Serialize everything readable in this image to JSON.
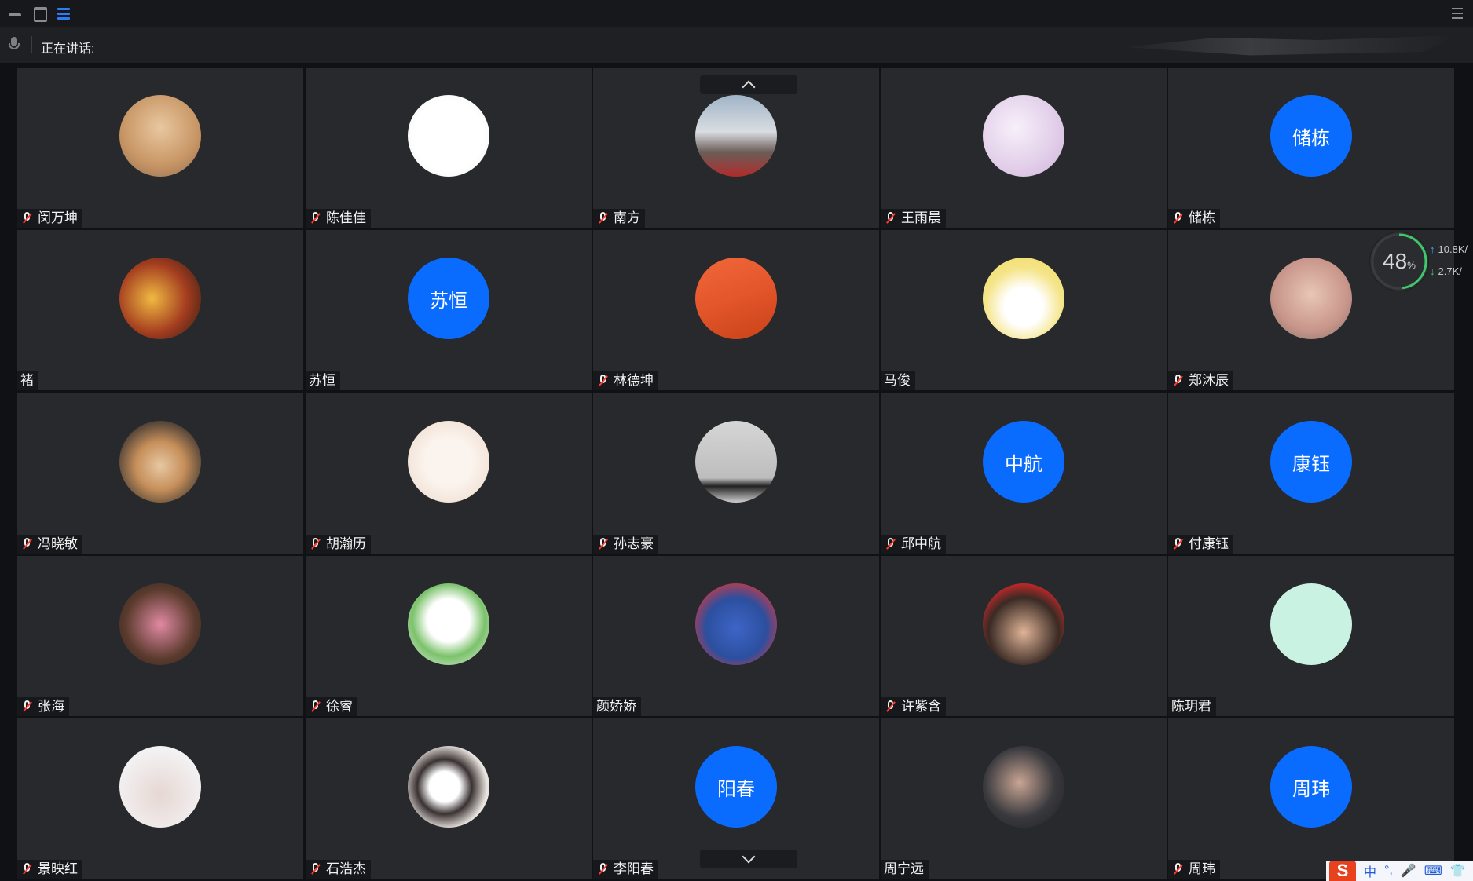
{
  "speaking": {
    "label": "正在讲话:"
  },
  "participants": [
    {
      "name": "闵万坤",
      "muted": true,
      "avatar": "cat-photo"
    },
    {
      "name": "陈佳佳",
      "muted": true,
      "avatar": "sketch-figure"
    },
    {
      "name": "南方",
      "muted": true,
      "avatar": "toy-photo"
    },
    {
      "name": "王雨晨",
      "muted": true,
      "avatar": "cartoon-cat"
    },
    {
      "name": "储栋",
      "muted": true,
      "avatar_text": "储栋"
    },
    {
      "name": "褚",
      "muted": false,
      "avatar": "anime-character"
    },
    {
      "name": "苏恒",
      "muted": false,
      "avatar_text": "苏恒"
    },
    {
      "name": "林德坤",
      "muted": true,
      "avatar": "desert-photo"
    },
    {
      "name": "马俊",
      "muted": false,
      "avatar": "cartoon-duck"
    },
    {
      "name": "郑沐辰",
      "muted": true,
      "avatar": "person-photo"
    },
    {
      "name": "冯晓敏",
      "muted": true,
      "avatar": "flowers-photo"
    },
    {
      "name": "胡瀚历",
      "muted": true,
      "avatar": "anime-girls"
    },
    {
      "name": "孙志豪",
      "muted": true,
      "avatar": "grey-landscape"
    },
    {
      "name": "邱中航",
      "muted": true,
      "avatar_text": "中航"
    },
    {
      "name": "付康钰",
      "muted": true,
      "avatar_text": "康钰"
    },
    {
      "name": "张海",
      "muted": true,
      "avatar": "cartoon-boy"
    },
    {
      "name": "徐睿",
      "muted": true,
      "avatar": "green-cartoon"
    },
    {
      "name": "颜娇娇",
      "muted": false,
      "avatar": "stitch-cartoon"
    },
    {
      "name": "许紫含",
      "muted": true,
      "avatar": "person-red-hair"
    },
    {
      "name": "陈玥君",
      "muted": false,
      "avatar": "mint-circle"
    },
    {
      "name": "景映红",
      "muted": true,
      "avatar": "light-portrait"
    },
    {
      "name": "石浩杰",
      "muted": true,
      "avatar": "penguin-cartoon"
    },
    {
      "name": "李阳春",
      "muted": true,
      "avatar_text": "阳春"
    },
    {
      "name": "周宁远",
      "muted": false,
      "avatar": "singer-photo"
    },
    {
      "name": "周玮",
      "muted": true,
      "avatar_text": "周玮"
    }
  ],
  "network": {
    "percent": "48",
    "percent_unit": "%",
    "upload": "10.8",
    "upload_unit": "K/",
    "download": "2.7",
    "download_unit": "K/"
  },
  "ime": {
    "logo": "S",
    "items": [
      "中",
      "°,",
      "🎤",
      "⌨",
      "👕"
    ]
  },
  "colors": {
    "text_avatar_bg": "#0a6cff",
    "cell_bg": "#27292d",
    "mute_slash": "#ff3b30"
  }
}
